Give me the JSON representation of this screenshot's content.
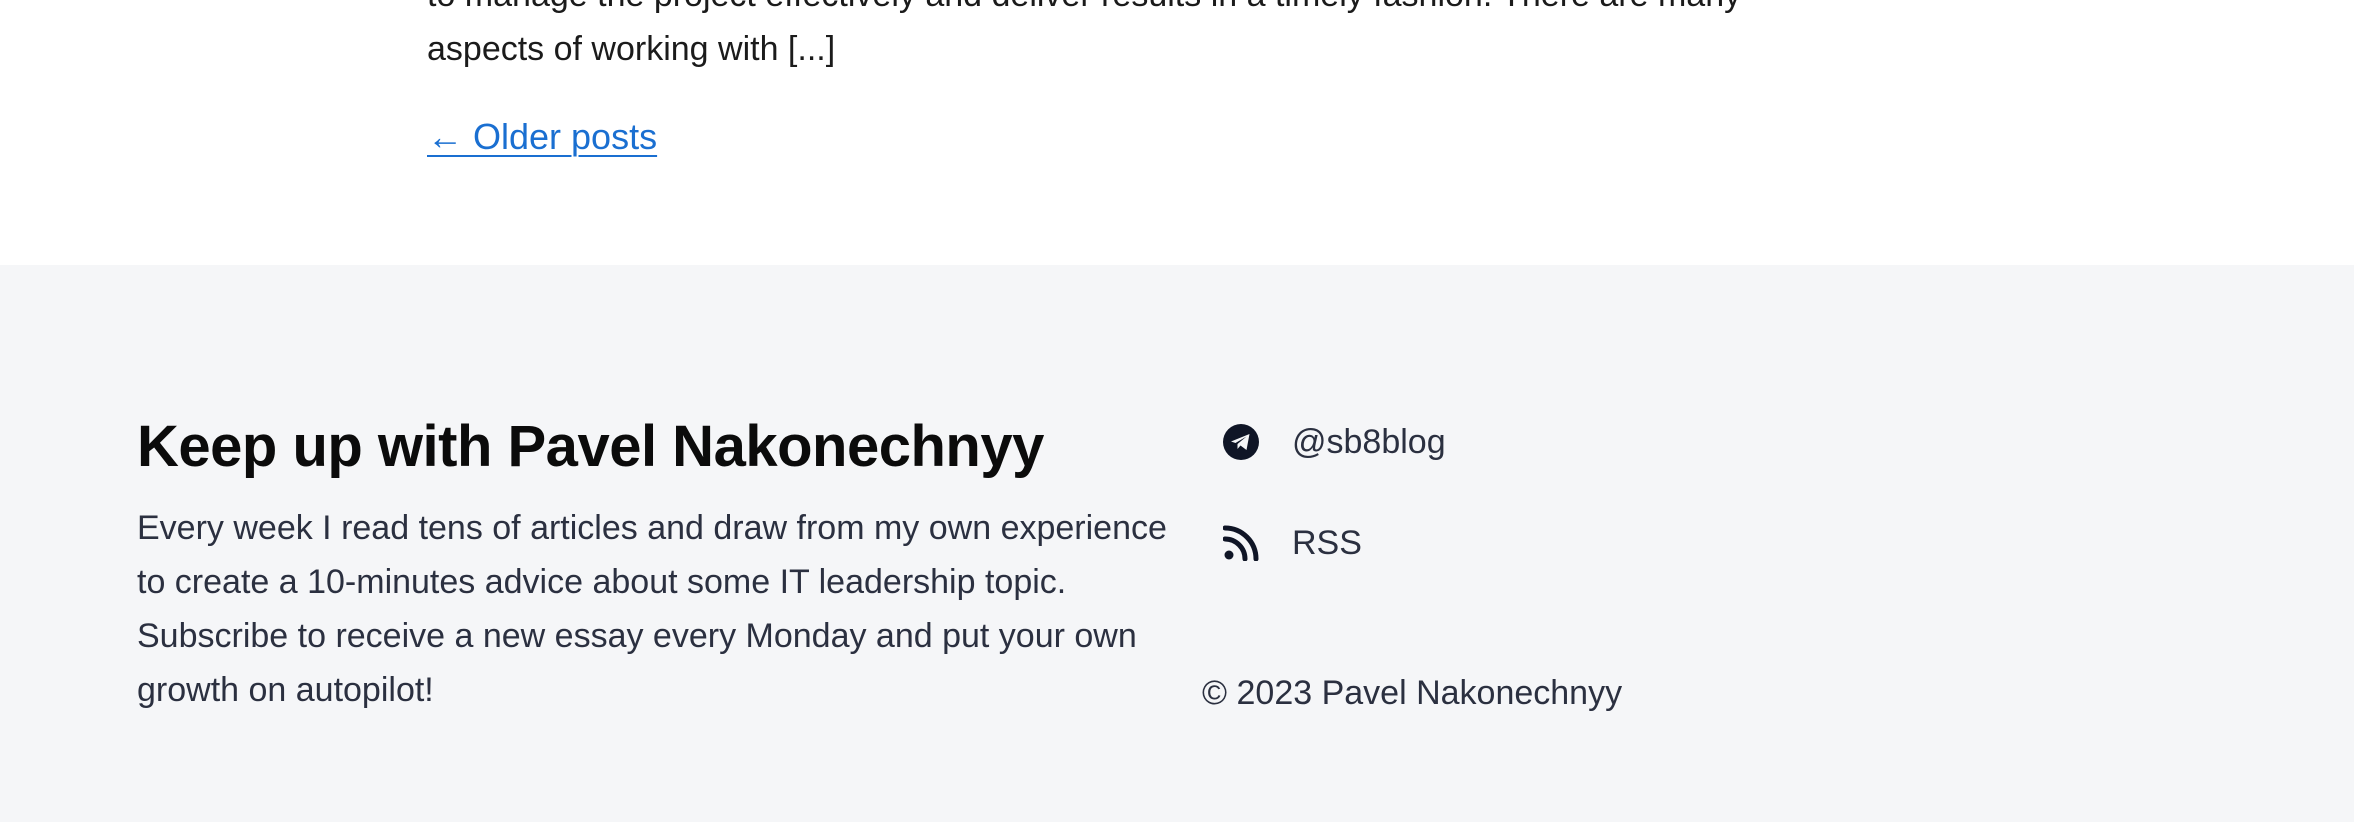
{
  "main": {
    "excerpt_line_1": "to manage the project effectively and deliver results in a timely fashion. There are many",
    "excerpt_line_2": "aspects of working with [...]",
    "older_posts_label": "← Older posts"
  },
  "footer": {
    "title": "Keep up with Pavel Nakonechnyy",
    "description": "Every week I read tens of articles and draw from my own experience to create a 10-minutes advice about some IT leadership topic. Subscribe to receive a new essay every Monday and put your own growth on autopilot!",
    "social": [
      {
        "icon": "telegram-icon",
        "label": "@sb8blog"
      },
      {
        "icon": "rss-icon",
        "label": "RSS"
      }
    ],
    "copyright": "© 2023 Pavel Nakonechnyy"
  },
  "colors": {
    "link": "#1a6fd1",
    "footer_background": "#f5f6f8",
    "text_dark": "#0b0b0b",
    "text_muted": "#2b3040",
    "icon": "#0f1526"
  }
}
